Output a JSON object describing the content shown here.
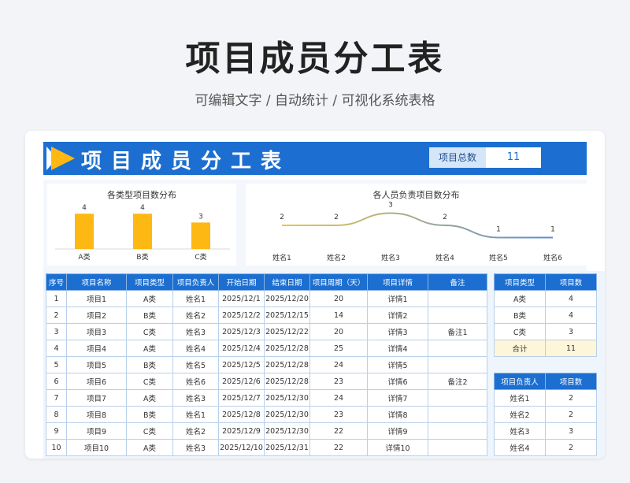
{
  "page": {
    "title": "项目成员分工表",
    "subtitle": "可编辑文字 / 自动统计 / 可视化系统表格"
  },
  "header": {
    "title": "项目成员分工表",
    "total_label": "项目总数",
    "total_value": "11"
  },
  "colors": {
    "banner": "#1c6fd0",
    "bar": "#fdb813",
    "arrow": "#fdb813",
    "line_start": "#e8c84a",
    "line_end": "#5b8fd0"
  },
  "chart_data": [
    {
      "type": "bar",
      "title": "各类型项目数分布",
      "categories": [
        "A类",
        "B类",
        "C类"
      ],
      "values": [
        4,
        4,
        3
      ],
      "ylim": [
        0,
        5
      ]
    },
    {
      "type": "line",
      "title": "各人员负责项目数分布",
      "categories": [
        "姓名1",
        "姓名2",
        "姓名3",
        "姓名4",
        "姓名5",
        "姓名6"
      ],
      "values": [
        2,
        2,
        3,
        2,
        1,
        1
      ],
      "ylim": [
        0,
        4
      ]
    }
  ],
  "main_table": {
    "headers": [
      "序号",
      "项目名称",
      "项目类型",
      "项目负责人",
      "开始日期",
      "结束日期",
      "项目周期（天）",
      "项目详情",
      "备注"
    ],
    "rows": [
      [
        "1",
        "项目1",
        "A类",
        "姓名1",
        "2025/12/1",
        "2025/12/20",
        "20",
        "详情1",
        ""
      ],
      [
        "2",
        "项目2",
        "B类",
        "姓名2",
        "2025/12/2",
        "2025/12/15",
        "14",
        "详情2",
        ""
      ],
      [
        "3",
        "项目3",
        "C类",
        "姓名3",
        "2025/12/3",
        "2025/12/22",
        "20",
        "详情3",
        "备注1"
      ],
      [
        "4",
        "项目4",
        "A类",
        "姓名4",
        "2025/12/4",
        "2025/12/28",
        "25",
        "详情4",
        ""
      ],
      [
        "5",
        "项目5",
        "B类",
        "姓名5",
        "2025/12/5",
        "2025/12/28",
        "24",
        "详情5",
        ""
      ],
      [
        "6",
        "项目6",
        "C类",
        "姓名6",
        "2025/12/6",
        "2025/12/28",
        "23",
        "详情6",
        "备注2"
      ],
      [
        "7",
        "项目7",
        "A类",
        "姓名3",
        "2025/12/7",
        "2025/12/30",
        "24",
        "详情7",
        ""
      ],
      [
        "8",
        "项目8",
        "B类",
        "姓名1",
        "2025/12/8",
        "2025/12/30",
        "23",
        "详情8",
        ""
      ],
      [
        "9",
        "项目9",
        "C类",
        "姓名2",
        "2025/12/9",
        "2025/12/30",
        "22",
        "详情9",
        ""
      ],
      [
        "10",
        "项目10",
        "A类",
        "姓名3",
        "2025/12/10",
        "2025/12/31",
        "22",
        "详情10",
        ""
      ]
    ]
  },
  "type_table": {
    "headers": [
      "项目类型",
      "项目数"
    ],
    "rows": [
      [
        "A类",
        "4"
      ],
      [
        "B类",
        "4"
      ],
      [
        "C类",
        "3"
      ]
    ],
    "total": [
      "合计",
      "11"
    ]
  },
  "person_table": {
    "headers": [
      "项目负责人",
      "项目数"
    ],
    "rows": [
      [
        "姓名1",
        "2"
      ],
      [
        "姓名2",
        "2"
      ],
      [
        "姓名3",
        "3"
      ],
      [
        "姓名4",
        "2"
      ]
    ]
  }
}
